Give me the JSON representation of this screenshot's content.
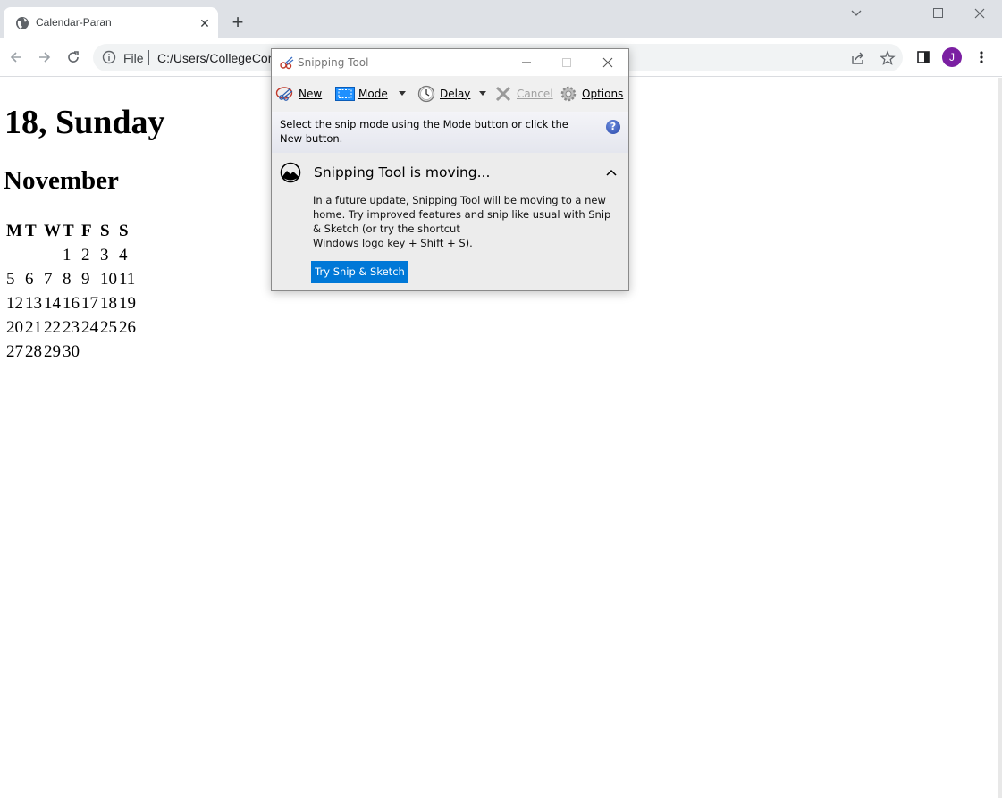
{
  "browser": {
    "tab_title": "Calendar-Paran",
    "new_tab_symbol": "+",
    "omnibox": {
      "scheme_label": "File",
      "url": "C:/Users/CollegeComputer/Desktop/Calendar-Paran.html"
    },
    "profile_initial": "J",
    "accent_color": "#7b1fa2"
  },
  "page": {
    "day_heading": "18, Sunday",
    "month_heading": "November",
    "calendar": {
      "headers": [
        "M",
        "T",
        "W",
        "T",
        "F",
        "S",
        "S"
      ],
      "rows": [
        [
          "",
          "",
          "",
          "1",
          "2",
          "3",
          "4"
        ],
        [
          "5",
          "6",
          "7",
          "8",
          "9",
          "10",
          "11"
        ],
        [
          "12",
          "13",
          "14",
          "16",
          "17",
          "18",
          "19"
        ],
        [
          "20",
          "21",
          "22",
          "23",
          "24",
          "25",
          "26"
        ],
        [
          "27",
          "28",
          "29",
          "30",
          "",
          "",
          ""
        ]
      ]
    }
  },
  "snipping_tool": {
    "title": "Snipping Tool",
    "toolbar": {
      "new_label": "New",
      "mode_label": "Mode",
      "delay_label": "Delay",
      "cancel_label": "Cancel",
      "options_label": "Options"
    },
    "hint": "Select the snip mode using the Mode button or click the New button.",
    "notice": {
      "title": "Snipping Tool is moving...",
      "body_lines": [
        "In a future update, Snipping Tool will be moving to a new",
        "home. Try improved features and snip like usual with Snip",
        "& Sketch (or try the shortcut",
        "Windows logo key + Shift + S)."
      ],
      "button_label": "Try Snip & Sketch",
      "button_color": "#0078d7"
    }
  }
}
